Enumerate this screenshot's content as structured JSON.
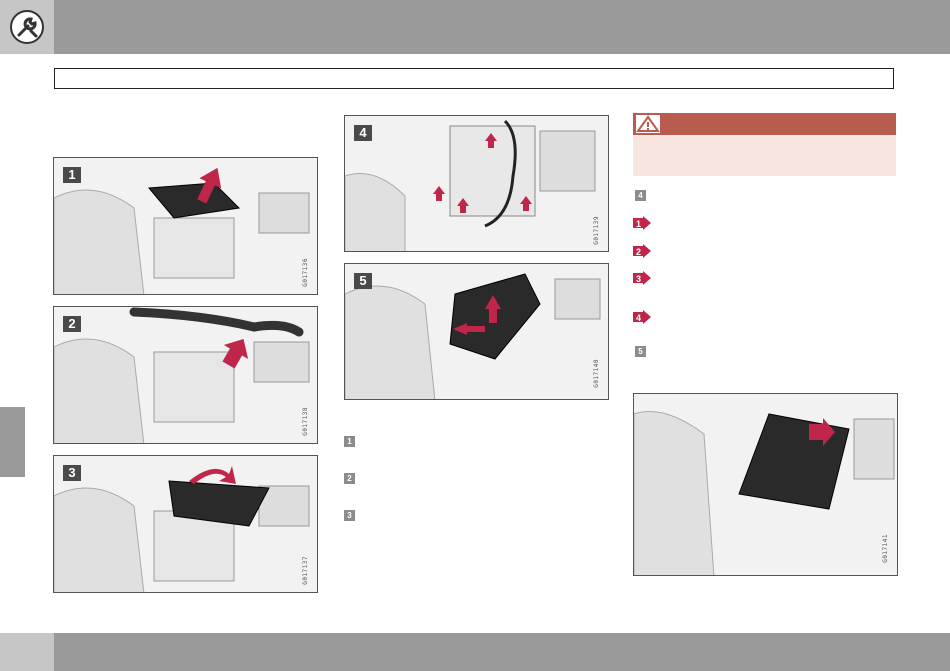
{
  "header": {
    "icon": "wrench-screwdriver-icon"
  },
  "figures": [
    {
      "number": "1",
      "code": "G017136"
    },
    {
      "number": "2",
      "code": "G017138"
    },
    {
      "number": "3",
      "code": "G017137"
    },
    {
      "number": "4",
      "code": "G017139"
    },
    {
      "number": "5",
      "code": "G017140"
    },
    {
      "number": "",
      "code": "G017141"
    }
  ],
  "step_markers": {
    "middle": [
      "1",
      "2",
      "3"
    ],
    "right_square_a": "4",
    "right_square_b": "5",
    "right_arrows": [
      "1",
      "2",
      "3",
      "4"
    ]
  },
  "colors": {
    "header_gray": "#9a9a9a",
    "accent_red": "#c0264a",
    "warning_red": "#b85c4f",
    "warning_bg": "#f7e6df"
  }
}
